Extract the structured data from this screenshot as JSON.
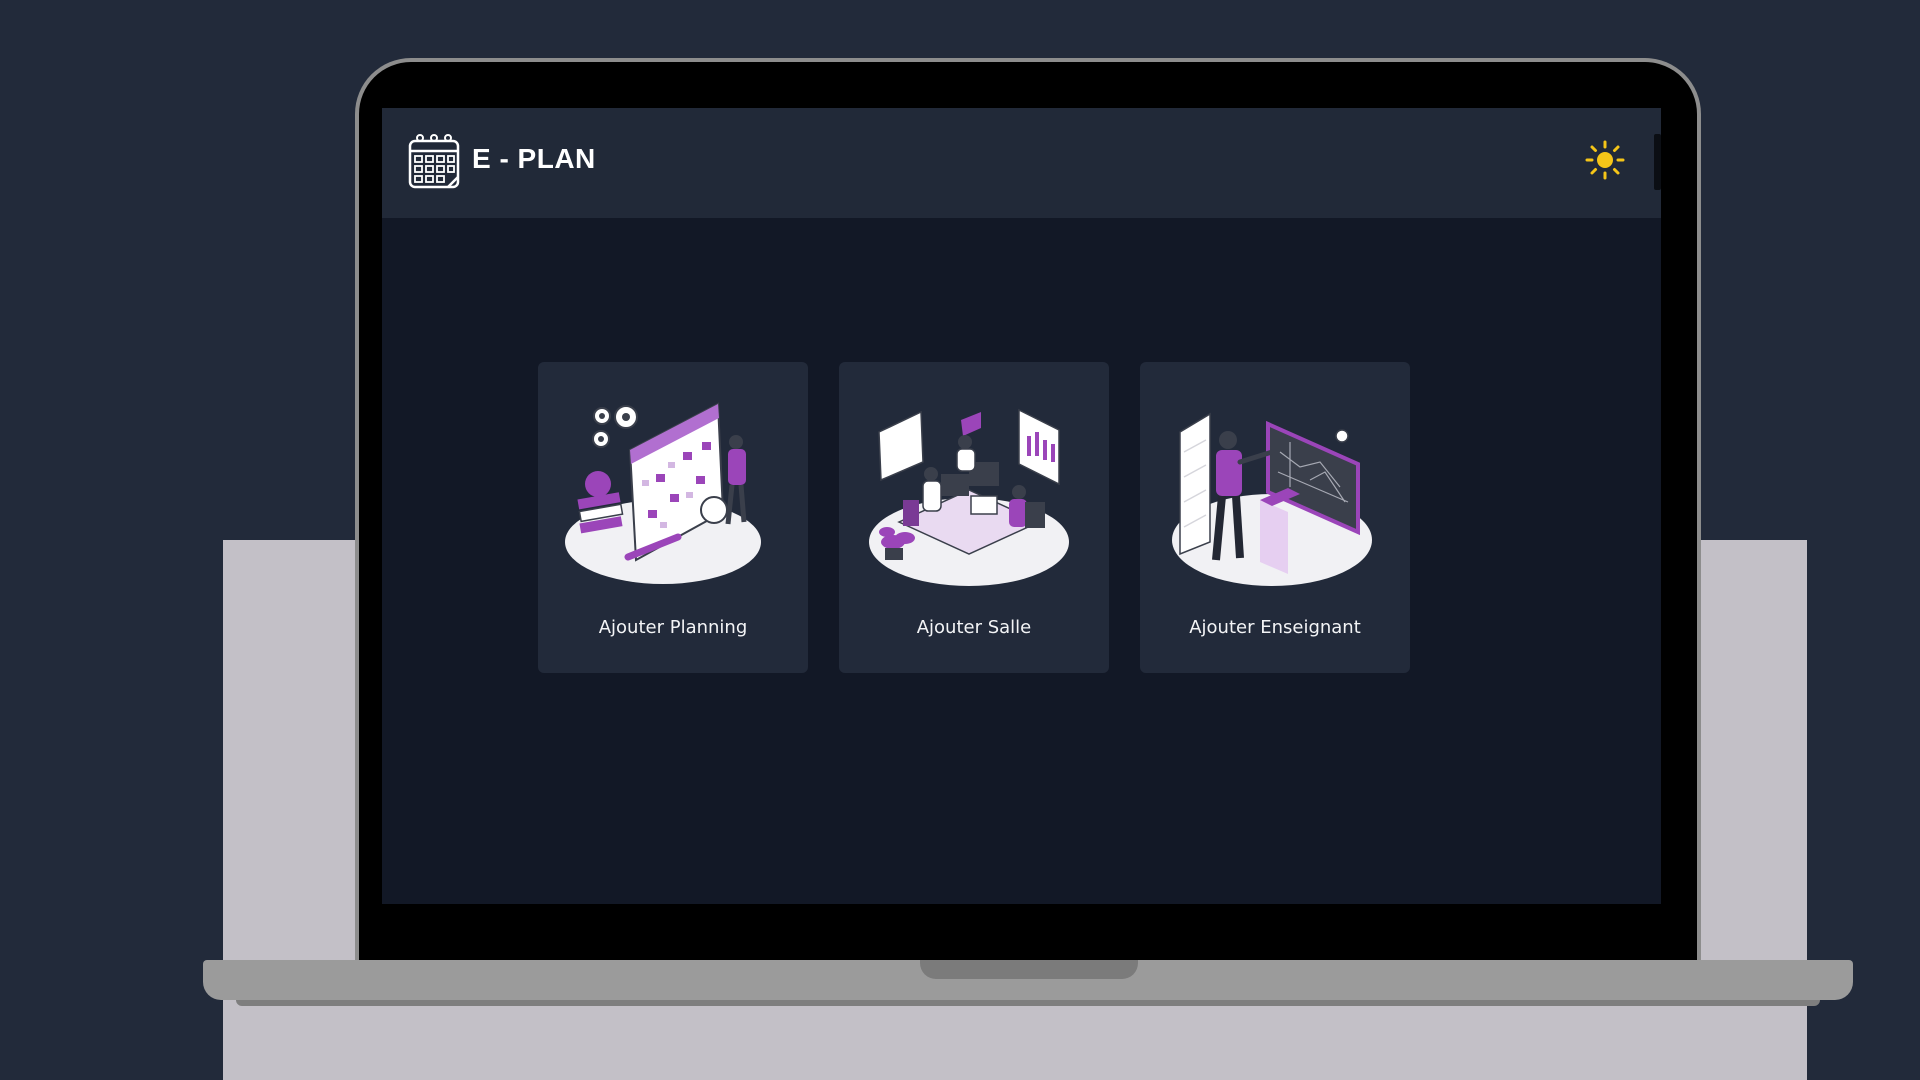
{
  "app": {
    "brand": "E - PLAN",
    "logo_icon": "calendar-icon",
    "theme_icon": "sun-icon"
  },
  "colors": {
    "page_background": "#222a3a",
    "header_background": "#212938",
    "screen_background": "#121826",
    "card_background": "#222a3a",
    "accent_purple": "#9b45b9",
    "sun_yellow": "#f5c518"
  },
  "cards": [
    {
      "label": "Ajouter Planning",
      "illustration": "planning-illustration"
    },
    {
      "label": "Ajouter Salle",
      "illustration": "room-illustration"
    },
    {
      "label": "Ajouter Enseignant",
      "illustration": "teacher-illustration"
    }
  ]
}
